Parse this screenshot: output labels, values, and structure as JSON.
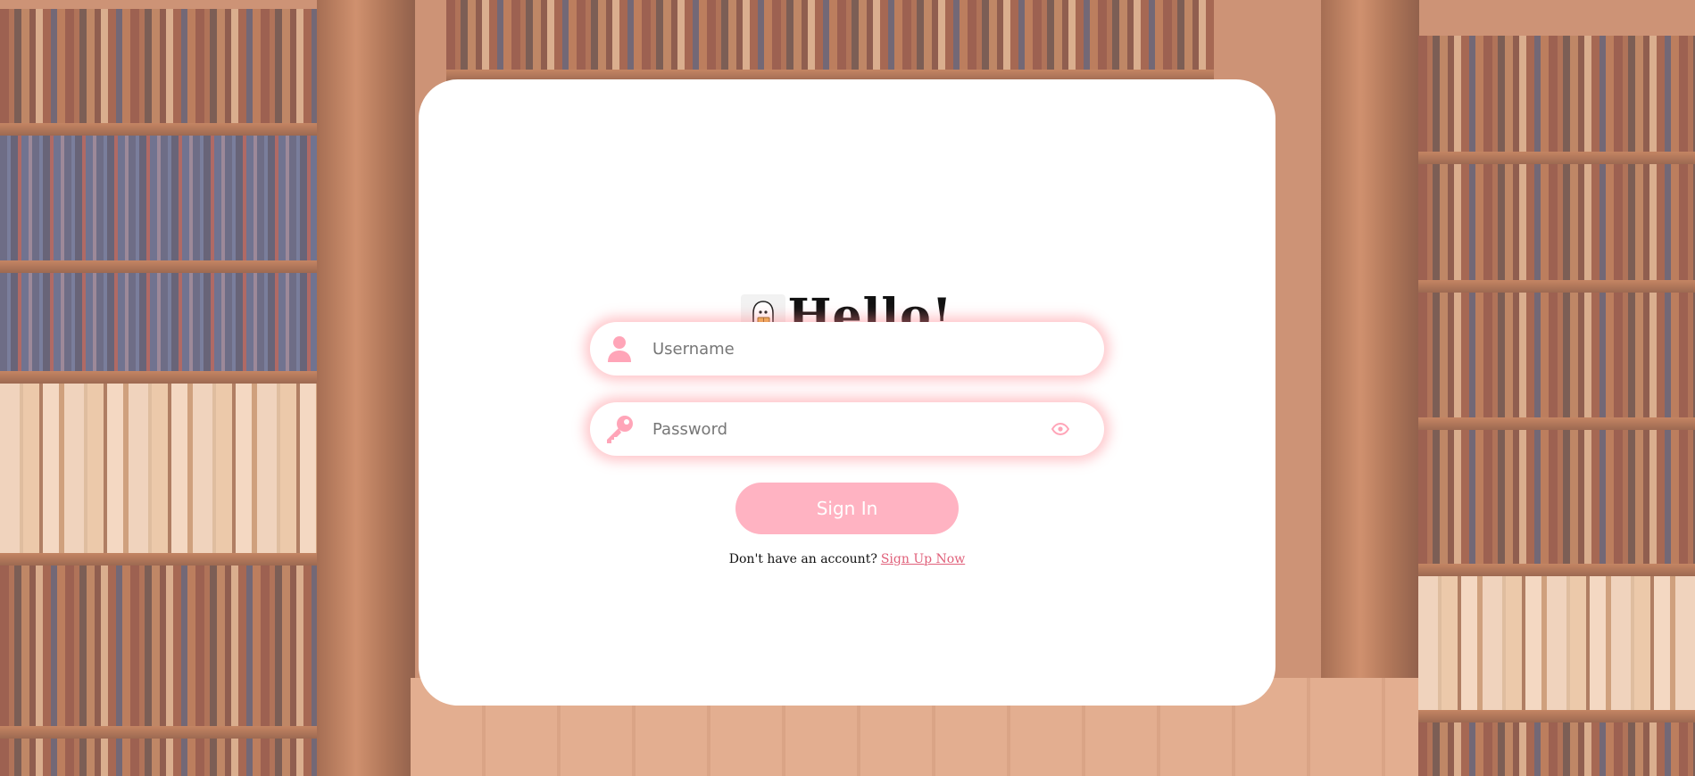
{
  "login": {
    "title": "Hello!",
    "username": {
      "placeholder": "Username",
      "value": ""
    },
    "password": {
      "placeholder": "Password",
      "value": ""
    },
    "signin_label": "Sign In",
    "signup_prompt": "Don't have an account?",
    "signup_link": "Sign Up Now"
  },
  "colors": {
    "accent": "#ffb3c2",
    "icon": "#ffa5b8",
    "link": "#e0607a",
    "glow": "#ff828c"
  },
  "icons": {
    "logo": "ghost-reading-icon",
    "username": "user-icon",
    "password": "key-icon",
    "toggle": "eye-icon"
  }
}
